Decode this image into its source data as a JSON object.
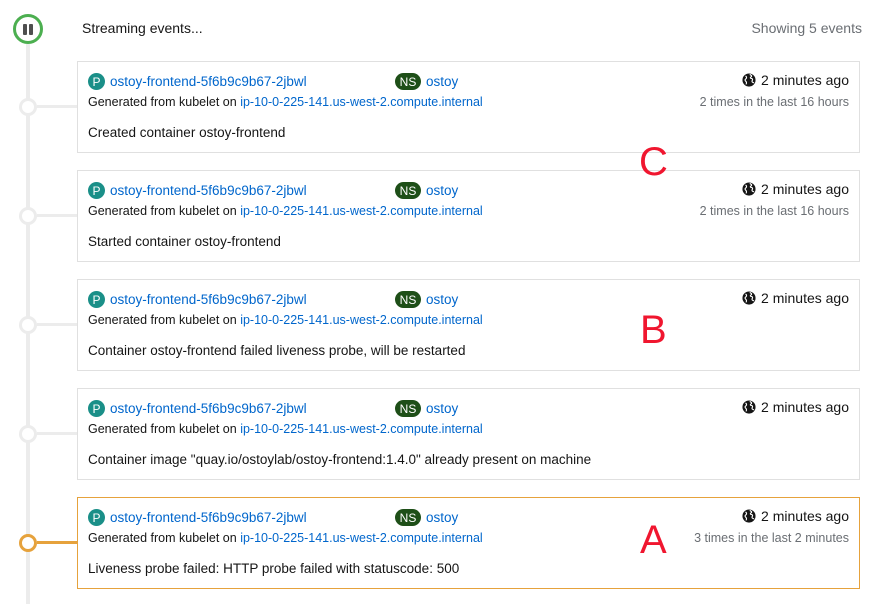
{
  "header": {
    "streaming_label": "Streaming events...",
    "showing_label": "Showing 5 events",
    "pause_icon": "pause-icon",
    "status_color": "#4caf50"
  },
  "events": [
    {
      "pod_badge": "P",
      "pod_name": "ostoy-frontend-5f6b9c9b67-2jbwl",
      "ns_badge": "NS",
      "namespace": "ostoy",
      "source_prefix": "Generated from kubelet on",
      "node_name": "ip-10-0-225-141.us-west-2.compute.internal",
      "message": "Created container ostoy-frontend",
      "time": "2 minutes ago",
      "count": "2 times in the last 16 hours",
      "type": "normal"
    },
    {
      "pod_badge": "P",
      "pod_name": "ostoy-frontend-5f6b9c9b67-2jbwl",
      "ns_badge": "NS",
      "namespace": "ostoy",
      "source_prefix": "Generated from kubelet on",
      "node_name": "ip-10-0-225-141.us-west-2.compute.internal",
      "message": "Started container ostoy-frontend",
      "time": "2 minutes ago",
      "count": "2 times in the last 16 hours",
      "type": "normal"
    },
    {
      "pod_badge": "P",
      "pod_name": "ostoy-frontend-5f6b9c9b67-2jbwl",
      "ns_badge": "NS",
      "namespace": "ostoy",
      "source_prefix": "Generated from kubelet on",
      "node_name": "ip-10-0-225-141.us-west-2.compute.internal",
      "message": "Container ostoy-frontend failed liveness probe, will be restarted",
      "time": "2 minutes ago",
      "count": "",
      "type": "normal"
    },
    {
      "pod_badge": "P",
      "pod_name": "ostoy-frontend-5f6b9c9b67-2jbwl",
      "ns_badge": "NS",
      "namespace": "ostoy",
      "source_prefix": "Generated from kubelet on",
      "node_name": "ip-10-0-225-141.us-west-2.compute.internal",
      "message": "Container image \"quay.io/ostoylab/ostoy-frontend:1.4.0\" already present on machine",
      "time": "2 minutes ago",
      "count": "",
      "type": "normal"
    },
    {
      "pod_badge": "P",
      "pod_name": "ostoy-frontend-5f6b9c9b67-2jbwl",
      "ns_badge": "NS",
      "namespace": "ostoy",
      "source_prefix": "Generated from kubelet on",
      "node_name": "ip-10-0-225-141.us-west-2.compute.internal",
      "message": "Liveness probe failed: HTTP probe failed with statuscode: 500",
      "time": "2 minutes ago",
      "count": "3 times in the last 2 minutes",
      "type": "warning"
    }
  ],
  "annotations": [
    "C",
    "B",
    "A"
  ],
  "colors": {
    "warning": "#e6a23c",
    "pod_badge": "#1a8f88",
    "ns_badge": "#1e4f18",
    "link": "#0066cc",
    "annotation": "#f0162f"
  }
}
